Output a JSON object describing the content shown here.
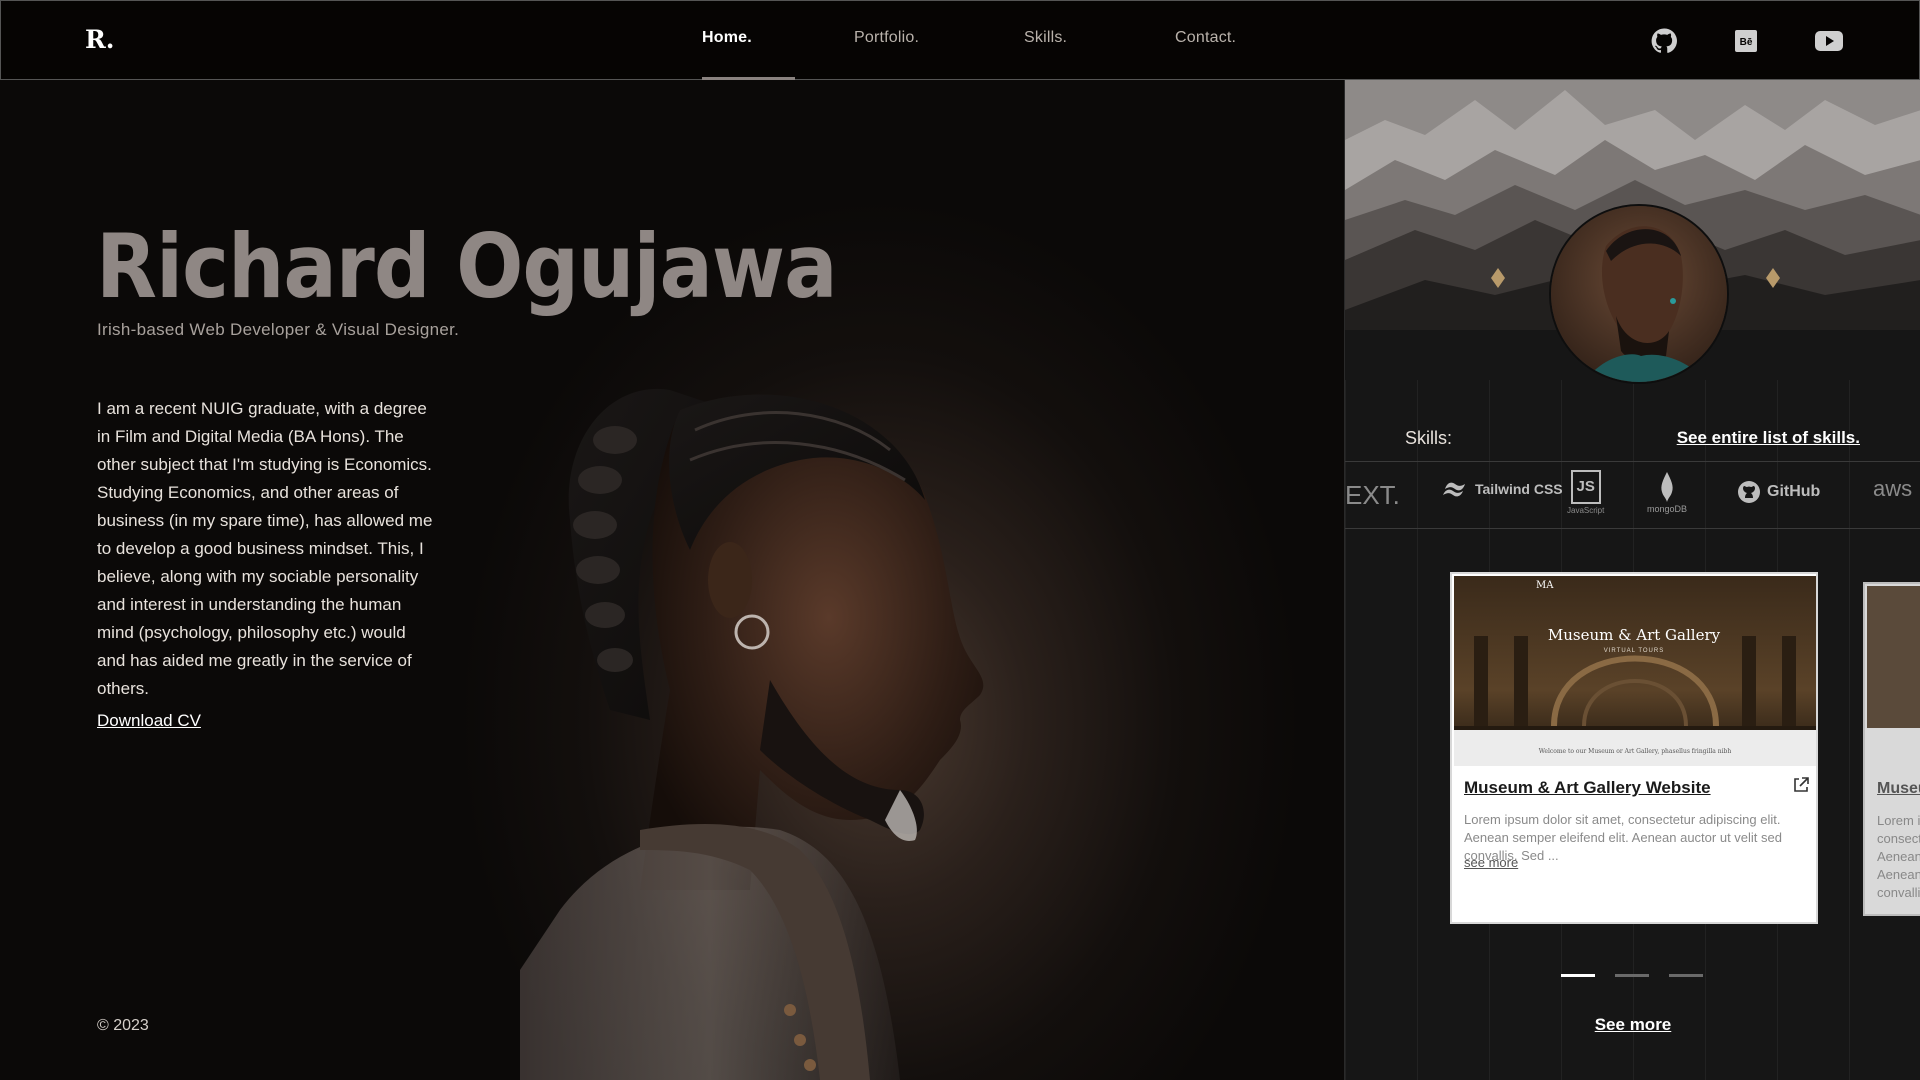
{
  "logo": "R.",
  "nav": {
    "links": [
      {
        "label": "Home."
      },
      {
        "label": "Portfolio."
      },
      {
        "label": "Skills."
      },
      {
        "label": "Contact."
      }
    ],
    "active": "Home.",
    "social": [
      "github-icon",
      "behance-icon",
      "youtube-icon"
    ]
  },
  "hero": {
    "name": "Richard Ogujawa",
    "subtitle": "Irish-based Web Developer & Visual Designer.",
    "bio": "I am a recent NUIG graduate, with a degree in Film and Digital Media (BA Hons). The other subject that I'm studying is Economics. Studying Economics, and other areas of business (in my spare time), has allowed me to develop a good business mindset. This, I believe, along with my sociable personality and interest in understanding the human mind (psychology, philosophy etc.) would and has aided me greatly in the service of others.",
    "cv_label": "Download CV",
    "copyright": "© 2023"
  },
  "sidebar": {
    "skills_label": "Skills:",
    "skills_link": "See entire list of skills.",
    "skill_logos": [
      "EXT.",
      "Tailwind CSS",
      "JS",
      "JavaScript",
      "mongoDB",
      "GitHub",
      "aws"
    ],
    "card": {
      "image_title": "Museum & Art Gallery",
      "image_subtitle": "VIRTUAL TOURS",
      "image_logo": "MA",
      "image_footer": "Welcome to our Museum or Art Gallery, phasellus fringilla nibh",
      "title": "Museum & Art Gallery Website",
      "text": "Lorem ipsum dolor sit amet, consectetur adipiscing elit. Aenean semper eleifend elit. Aenean auctor ut velit sed convallis. Sed ...",
      "more": "see more"
    },
    "card_next": {
      "title": "Museum & Art Gallery Website",
      "text": "Lorem ipsum dolor sit amet, consectetur adipiscing elit. Aenean semper eleifend elit. Aenean auctor ut velit sed convallis."
    },
    "carousel_total": 3,
    "carousel_active": 1,
    "see_more": "See more"
  },
  "colors": {
    "accent": "#ffffff",
    "muted_name": "#8f8784",
    "panel_bg": "#161616"
  }
}
